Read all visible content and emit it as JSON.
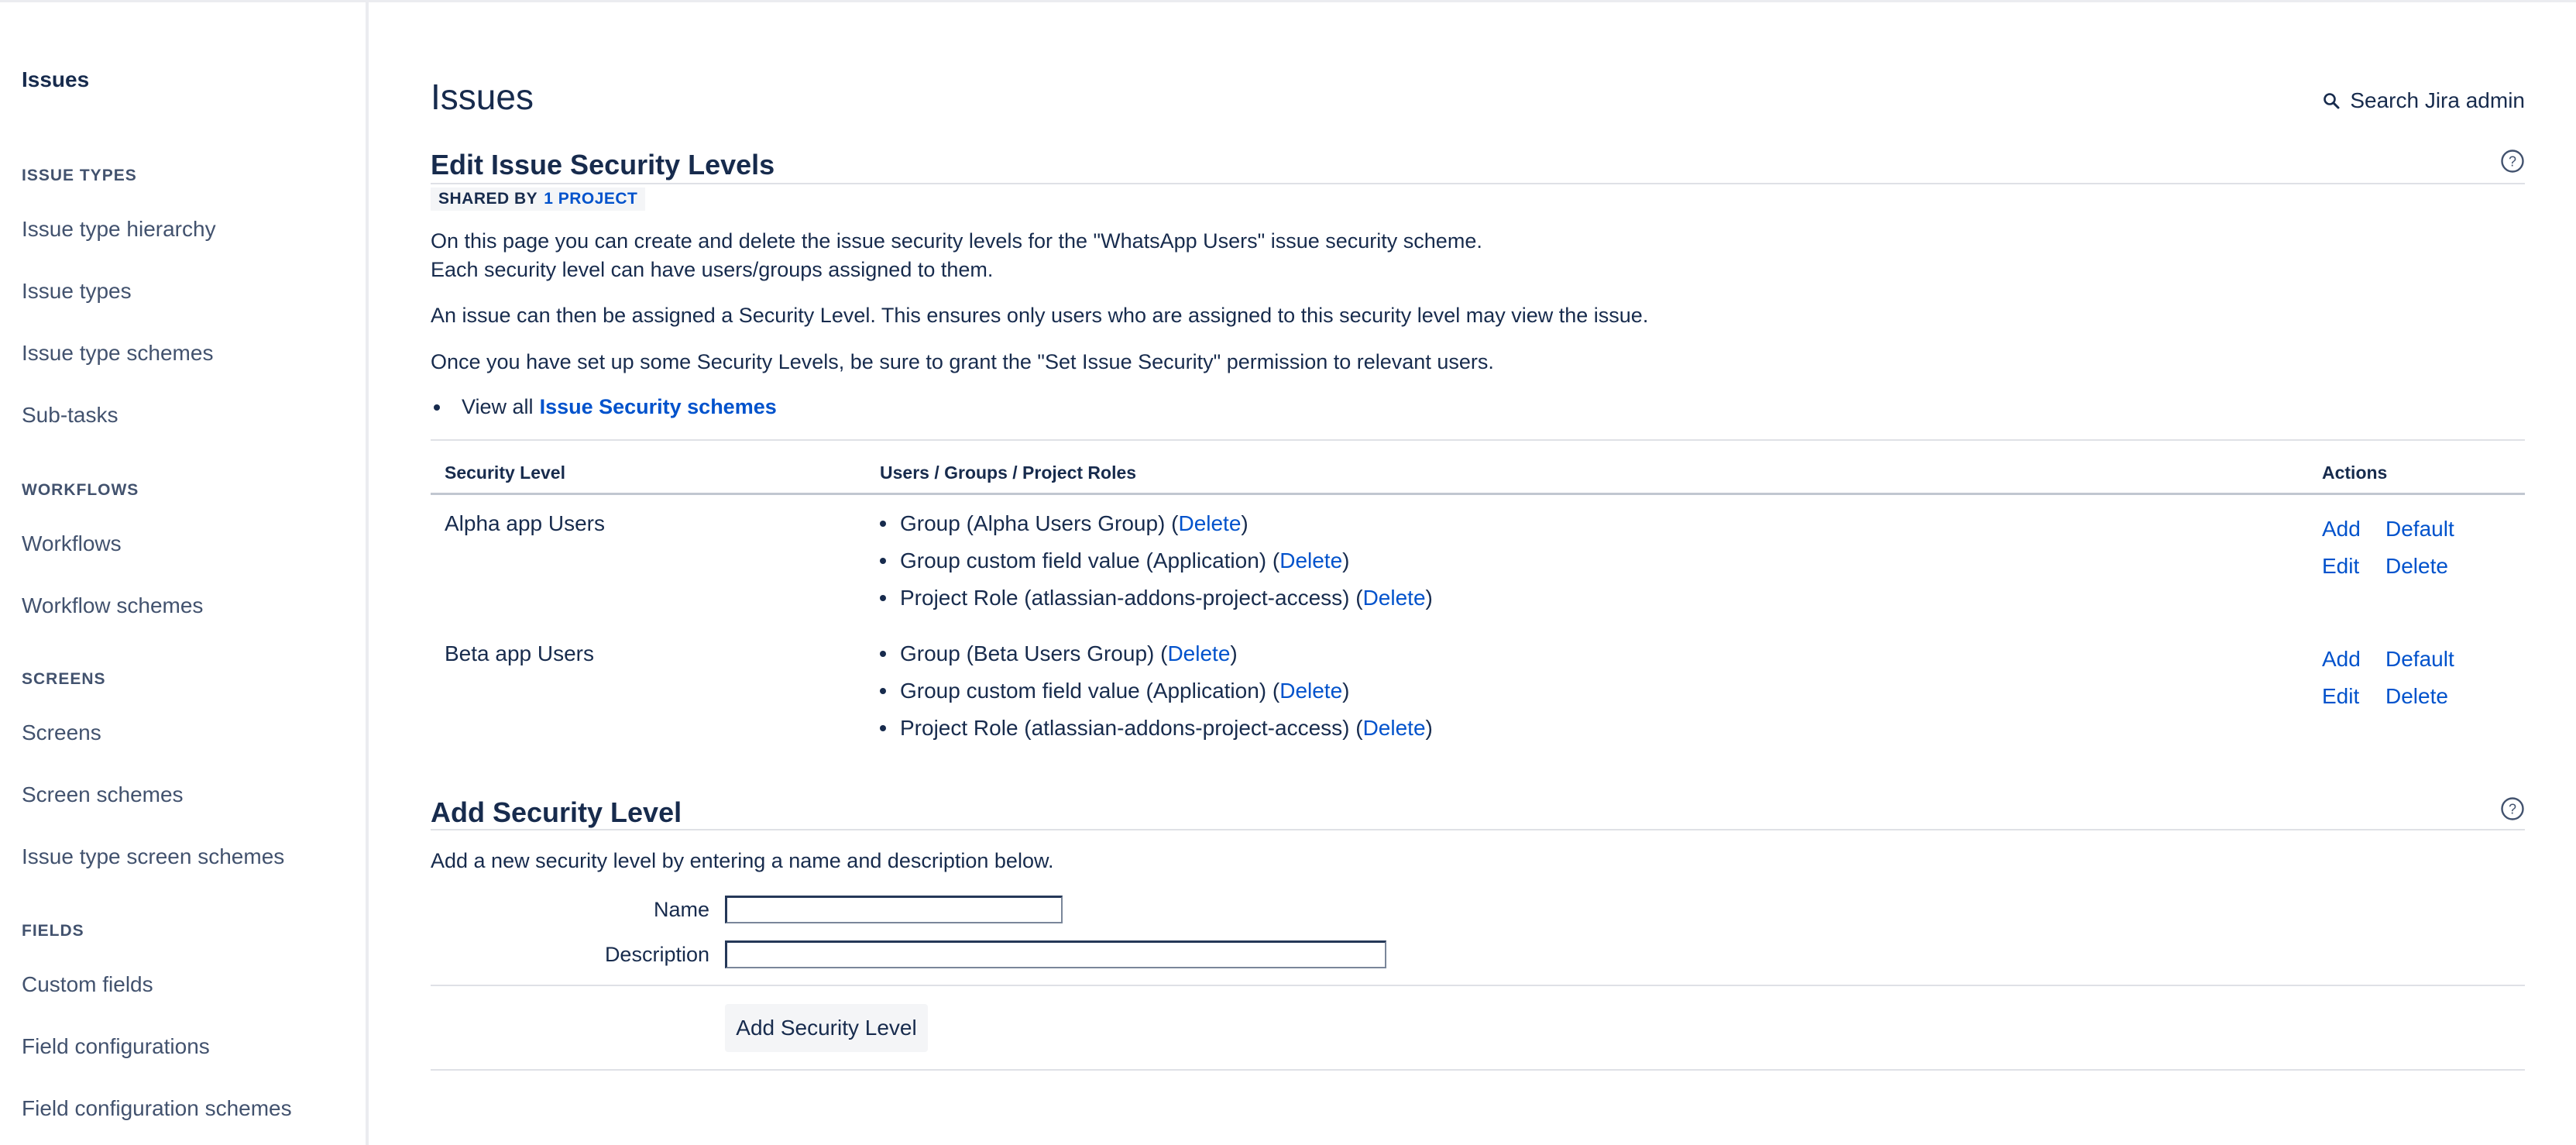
{
  "sidebar": {
    "title": "Issues",
    "sections": [
      {
        "heading": "ISSUE TYPES",
        "items": [
          "Issue type hierarchy",
          "Issue types",
          "Issue type schemes",
          "Sub-tasks"
        ]
      },
      {
        "heading": "WORKFLOWS",
        "items": [
          "Workflows",
          "Workflow schemes"
        ]
      },
      {
        "heading": "SCREENS",
        "items": [
          "Screens",
          "Screen schemes",
          "Issue type screen schemes"
        ]
      },
      {
        "heading": "FIELDS",
        "items": [
          "Custom fields",
          "Field configurations",
          "Field configuration schemes"
        ]
      }
    ]
  },
  "header": {
    "title": "Issues",
    "search_label": "Search Jira admin"
  },
  "edit_section": {
    "title": "Edit Issue Security Levels",
    "shared_by_label": "SHARED BY",
    "shared_by_link": "1 PROJECT",
    "para1_line1": "On this page you can create and delete the issue security levels for the \"WhatsApp Users\" issue security scheme.",
    "para1_line2": "Each security level can have users/groups assigned to them.",
    "para2": "An issue can then be assigned a Security Level. This ensures only users who are assigned to this security level may view the issue.",
    "para3": "Once you have set up some Security Levels, be sure to grant the \"Set Issue Security\" permission to relevant users.",
    "view_all_prefix": "View all",
    "view_all_link": "Issue Security schemes"
  },
  "table": {
    "headers": [
      "Security Level",
      "Users / Groups / Project Roles",
      "Actions"
    ],
    "delete_label": "Delete",
    "rows": [
      {
        "name": "Alpha app Users",
        "members": [
          {
            "text": "Group (Alpha Users Group) (",
            "close": ")"
          },
          {
            "text": "Group custom field value (Application) (",
            "close": ")"
          },
          {
            "text": "Project Role (atlassian-addons-project-access) (",
            "close": ")"
          }
        ],
        "actions": [
          "Add",
          "Default",
          "Edit",
          "Delete"
        ]
      },
      {
        "name": "Beta app Users",
        "members": [
          {
            "text": "Group (Beta Users Group) (",
            "close": ")"
          },
          {
            "text": "Group custom field value (Application) (",
            "close": ")"
          },
          {
            "text": "Project Role (atlassian-addons-project-access) (",
            "close": ")"
          }
        ],
        "actions": [
          "Add",
          "Default",
          "Edit",
          "Delete"
        ]
      }
    ]
  },
  "add_section": {
    "title": "Add Security Level",
    "description": "Add a new security level by entering a name and description below.",
    "name_label": "Name",
    "name_value": "",
    "description_label": "Description",
    "description_value": "",
    "submit_label": "Add Security Level"
  },
  "colors": {
    "link": "#0052cc",
    "text": "#172b4d",
    "muted": "#42526e"
  }
}
